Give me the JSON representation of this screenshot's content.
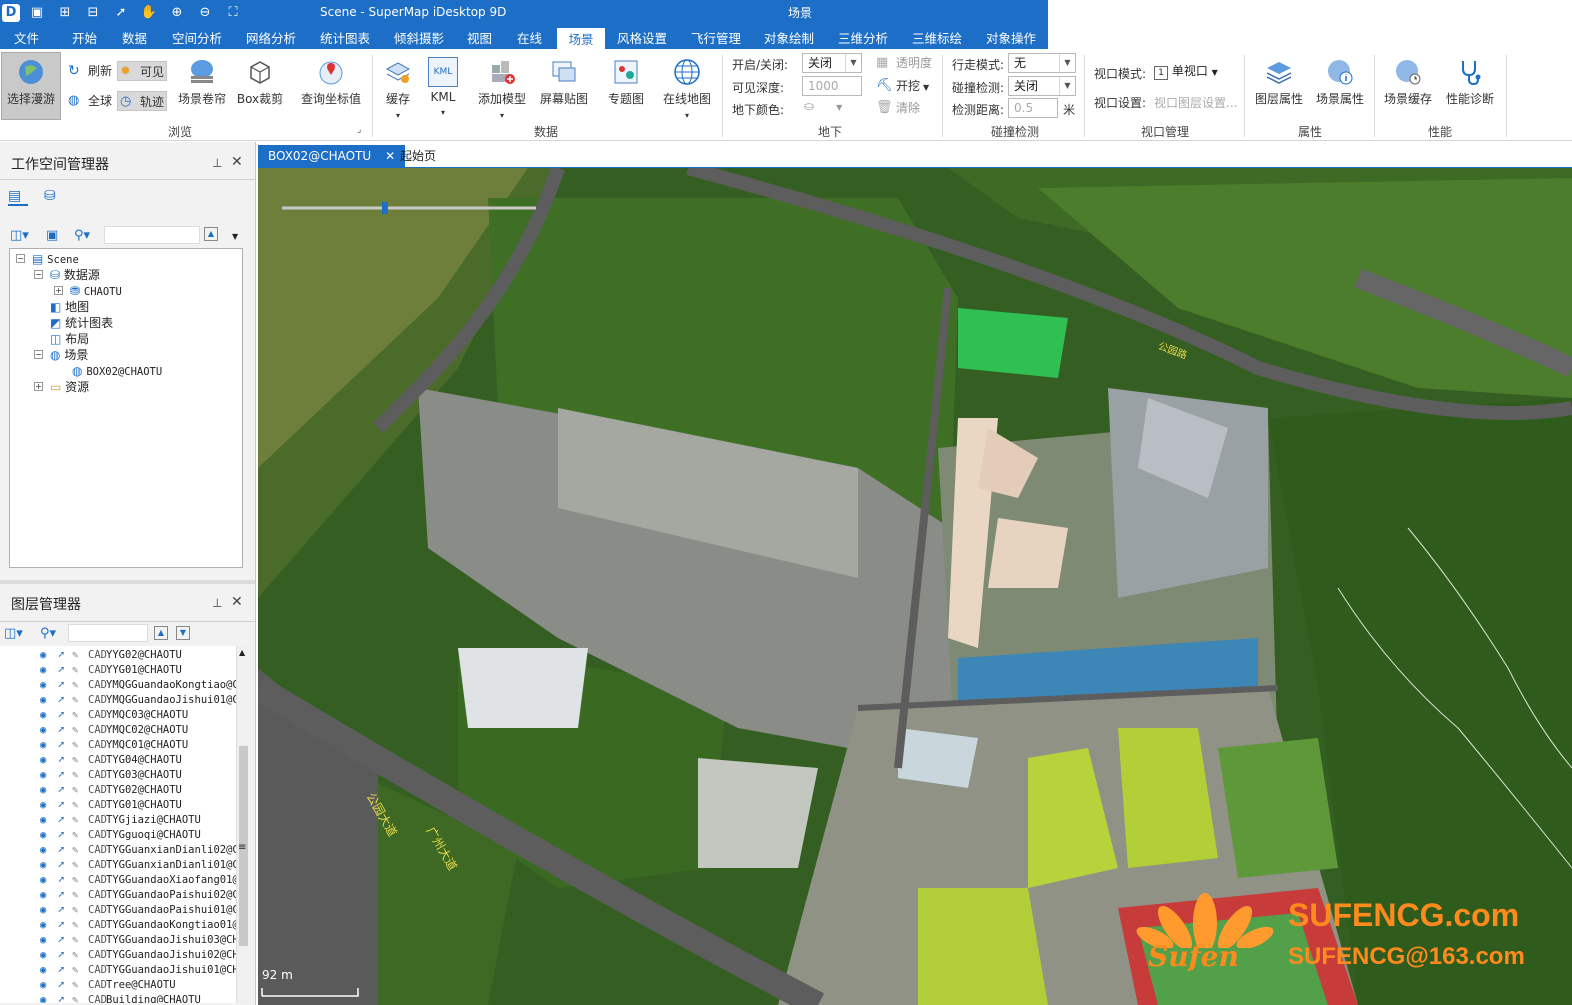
{
  "app": {
    "title": "Scene - SuperMap iDesktop 9D",
    "context_tab": "场景"
  },
  "menu": [
    "文件",
    "开始",
    "数据",
    "空间分析",
    "网络分析",
    "统计图表",
    "倾斜摄影",
    "视图",
    "在线",
    "场景",
    "风格设置",
    "飞行管理",
    "对象绘制",
    "三维分析",
    "三维标绘",
    "对象操作"
  ],
  "ribbon": {
    "browse": {
      "select_roam": "选择漫游",
      "refresh": "刷新",
      "visible": "可见",
      "globe": "全球",
      "track": "轨迹",
      "roller": "场景卷帘",
      "box_clip": "Box裁剪",
      "query_coord": "查询坐标值",
      "label": "浏览"
    },
    "data": {
      "cache": "缓存",
      "kml": "KML",
      "kml_icon": "KML",
      "add_model": "添加模型",
      "screen_image": "屏幕贴图",
      "thematic": "专题图",
      "online_map": "在线地图",
      "label": "数据"
    },
    "underground": {
      "onoff_label": "开启/关闭:",
      "onoff_value": "关闭",
      "depth_label": "可见深度:",
      "depth_value": "1000",
      "color_label": "地下颜色:",
      "transparency": "透明度",
      "excavate": "开挖",
      "clear": "清除",
      "label": "地下"
    },
    "collision": {
      "walk_label": "行走模式:",
      "walk_value": "无",
      "detect_label": "碰撞检测:",
      "detect_value": "关闭",
      "distance_label": "检测距离:",
      "distance_value": "0.5",
      "unit": "米",
      "label": "碰撞检测"
    },
    "viewport": {
      "mode_label": "视口模式:",
      "mode_value": "单视口",
      "mode_num": "1",
      "setting_label": "视口设置:",
      "setting_value": "视口图层设置...",
      "label": "视口管理"
    },
    "props": {
      "layer": "图层属性",
      "scene": "场景属性",
      "label": "属性"
    },
    "perf": {
      "cache": "场景缓存",
      "diag": "性能诊断",
      "label": "性能"
    }
  },
  "workspace": {
    "title": "工作空间管理器",
    "tree": {
      "root": "Scene",
      "datasource": "数据源",
      "ds_item": "CHAOTU",
      "map": "地图",
      "chart": "统计图表",
      "layout": "布局",
      "scene": "场景",
      "scene_item": "BOX02@CHAOTU",
      "resource": "资源"
    }
  },
  "layer_manager": {
    "title": "图层管理器",
    "layers": [
      "YYG02@CHAOTU",
      "YYG01@CHAOTU",
      "YMQGGuandaoKongtiao@CI",
      "YMQGGuandaoJishui01@CI",
      "YMQC03@CHAOTU",
      "YMQC02@CHAOTU",
      "YMQC01@CHAOTU",
      "TYG04@CHAOTU",
      "TYG03@CHAOTU",
      "TYG02@CHAOTU",
      "TYG01@CHAOTU",
      "TYGjiazi@CHAOTU",
      "TYGguoqi@CHAOTU",
      "TYGGuanxianDianli02@CI",
      "TYGGuanxianDianli01@CI",
      "TYGGuandaoXiaofang01@CI",
      "TYGGuandaoPaishui02@CI",
      "TYGGuandaoPaishui01@CI",
      "TYGGuandaoKongtiao01@CI",
      "TYGGuandaoJishui03@CHA",
      "TYGGuandaoJishui02@CHA",
      "TYGGuandaoJishui01@CHA",
      "Tree@CHAOTU",
      "Building@CHAOTU"
    ],
    "cad_tag": "CAD"
  },
  "tabs": [
    "BOX02@CHAOTU",
    "起始页"
  ],
  "scene": {
    "scale": "92 m",
    "road1": "公园大道",
    "road2": "广州大道",
    "road3": "公园路"
  },
  "watermark": {
    "brand": "SUFENCG.com",
    "email": "SUFENCG@163.com",
    "script": "Sufen"
  },
  "colors": {
    "accent": "#1c6ec6",
    "watermark": "#ff8a1e"
  }
}
